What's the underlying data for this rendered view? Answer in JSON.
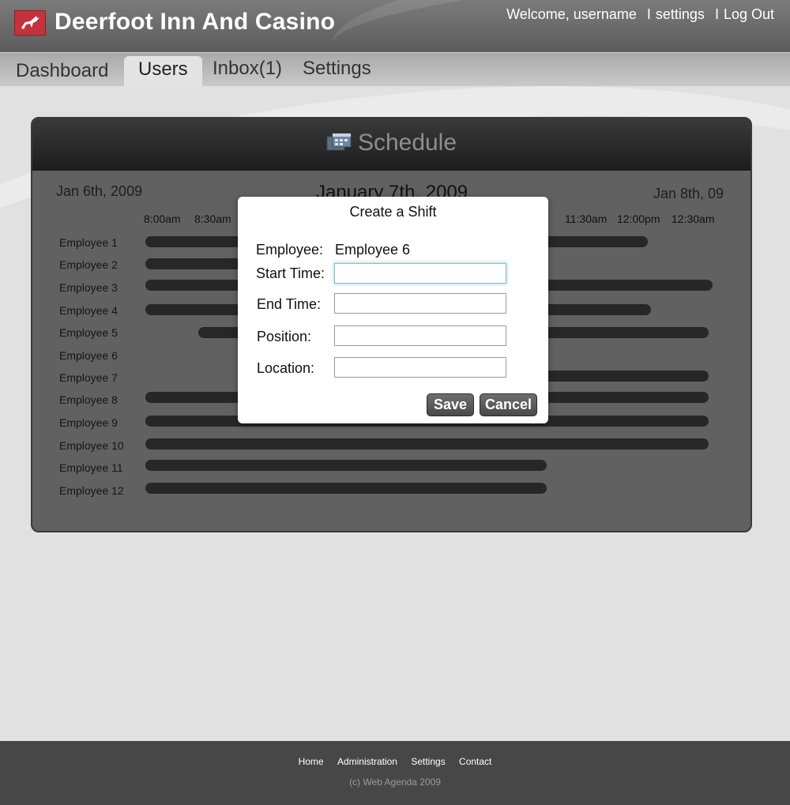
{
  "header": {
    "site_title": "Deerfoot Inn And Casino",
    "welcome": "Welcome, username",
    "settings_link": "settings",
    "logout_link": "Log Out",
    "separator": "I"
  },
  "tabs": [
    {
      "label": "Dashboard",
      "active": false
    },
    {
      "label": "Users",
      "active": true
    },
    {
      "label": "Inbox(1)",
      "active": false
    },
    {
      "label": "Settings",
      "active": false
    }
  ],
  "schedule": {
    "title": "Schedule",
    "prev_date": "Jan 6th, 2009",
    "current_date": "January 7th, 2009",
    "next_date": "Jan 8th, 09",
    "times": [
      "8:00am",
      "8:30am",
      "11:30am",
      "12:00pm",
      "12:30am"
    ],
    "employees": [
      "Employee 1",
      "Employee 2",
      "Employee 3",
      "Employee 4",
      "Employee 5",
      "Employee 6",
      "Employee 7",
      "Employee 8",
      "Employee 9",
      "Employee 10",
      "Employee 11",
      "Employee 12"
    ]
  },
  "modal": {
    "title": "Create a Shift",
    "employee_label": "Employee:",
    "employee_value": "Employee 6",
    "start_label": "Start Time:",
    "end_label": "End Time:",
    "position_label": "Position:",
    "location_label": "Location:",
    "start_value": "",
    "end_value": "",
    "position_value": "",
    "location_value": "",
    "save_label": "Save",
    "cancel_label": "Cancel"
  },
  "footer": {
    "links": [
      "Home",
      "Administration",
      "Settings",
      "Contact"
    ],
    "copyright": "(c) Web Agenda 2009"
  }
}
